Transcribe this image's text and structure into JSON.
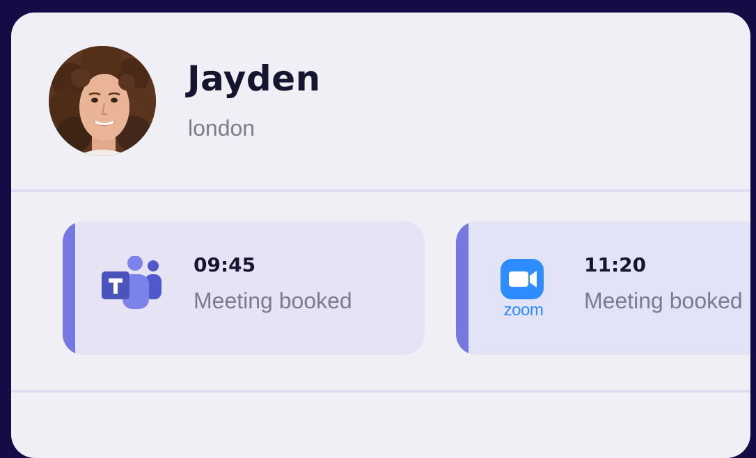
{
  "profile": {
    "name": "Jayden",
    "location": "london",
    "avatar_icon": "person-photo"
  },
  "meetings": [
    {
      "app_icon": "microsoft-teams-icon",
      "time": "09:45",
      "status": "Meeting booked",
      "accent_color": "#7478e0"
    },
    {
      "app_icon": "zoom-icon",
      "app_label": "zoom",
      "time": "11:20",
      "status": "Meeting booked",
      "accent_color": "#7478e0"
    }
  ],
  "colors": {
    "background": "#150b45",
    "card": "#f0eff5",
    "divider": "#dfdcf4",
    "accent": "#7478e0",
    "zoom_blue": "#2d8cff",
    "teams_purple": "#5059c9"
  }
}
